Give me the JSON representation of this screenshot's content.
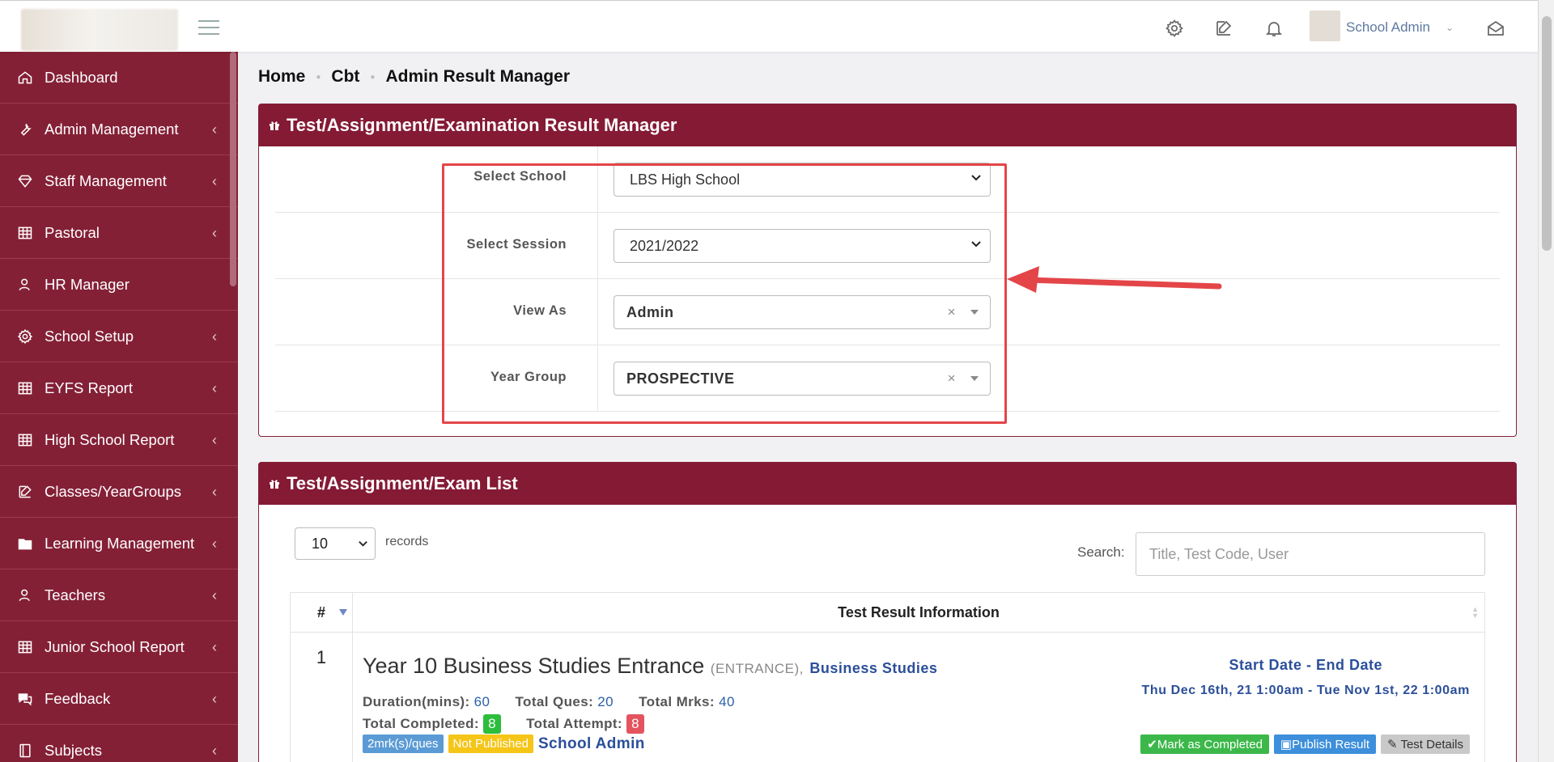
{
  "header": {
    "user_name": "School Admin",
    "icons": [
      "gear-icon",
      "edit-icon",
      "bell-icon",
      "mail-open-icon"
    ]
  },
  "sidebar": {
    "items": [
      {
        "label": "Dashboard",
        "icon": "home-icon",
        "has_chevron": false
      },
      {
        "label": "Admin Management",
        "icon": "wrench-icon",
        "has_chevron": true
      },
      {
        "label": "Staff Management",
        "icon": "diamond-icon",
        "has_chevron": true
      },
      {
        "label": "Pastoral",
        "icon": "grid-icon",
        "has_chevron": true
      },
      {
        "label": "HR Manager",
        "icon": "user-icon",
        "has_chevron": false
      },
      {
        "label": "School Setup",
        "icon": "gear-icon",
        "has_chevron": true
      },
      {
        "label": "EYFS Report",
        "icon": "grid-icon",
        "has_chevron": true
      },
      {
        "label": "High School Report",
        "icon": "grid-icon",
        "has_chevron": true
      },
      {
        "label": "Classes/YearGroups",
        "icon": "edit-icon",
        "has_chevron": true
      },
      {
        "label": "Learning Management",
        "icon": "folder-icon",
        "has_chevron": true
      },
      {
        "label": "Teachers",
        "icon": "user-icon",
        "has_chevron": true
      },
      {
        "label": "Junior School Report",
        "icon": "grid-icon",
        "has_chevron": true
      },
      {
        "label": "Feedback",
        "icon": "chat-icon",
        "has_chevron": true
      },
      {
        "label": "Subjects",
        "icon": "book-icon",
        "has_chevron": true
      }
    ],
    "chevron": "‹"
  },
  "breadcrumb": [
    "Home",
    "Cbt",
    "Admin Result Manager"
  ],
  "filter_panel": {
    "title": "Test/Assignment/Examination Result Manager",
    "fields": [
      {
        "label": "Select School",
        "value": "LBS High School",
        "kind": "select"
      },
      {
        "label": "Select Session",
        "value": "2021/2022",
        "kind": "select"
      },
      {
        "label": "View As",
        "value": "Admin",
        "kind": "select2"
      },
      {
        "label": "Year Group",
        "value": "PROSPECTIVE",
        "kind": "select2"
      }
    ],
    "clear_glyph": "×"
  },
  "list_panel": {
    "title": "Test/Assignment/Exam List",
    "page_length": "10",
    "records_label": "records",
    "search_label": "Search:",
    "search_placeholder": "Title, Test Code, User",
    "columns": [
      "#",
      "Test Result Information"
    ],
    "rows": [
      {
        "index": "1",
        "title": "Year 10 Business Studies Entrance",
        "code": "(ENTRANCE),",
        "subject": "Business Studies",
        "duration_label": "Duration(mins):",
        "duration": "60",
        "ques_label": "Total Ques:",
        "ques": "20",
        "marks_label": "Total Mrks:",
        "marks": "40",
        "completed_label": "Total Completed:",
        "completed": "8",
        "attempt_label": "Total Attempt:",
        "attempt": "8",
        "tag_marks": "2mrk(s)/ques",
        "tag_status": "Not Published",
        "author": "School Admin",
        "dates_heading": "Start Date - End Date",
        "dates_value": "Thu Dec 16th, 21 1:00am - Tue Nov 1st, 22 1:00am",
        "actions": [
          "✔Mark as Completed",
          "Publish Result",
          "Test Details"
        ]
      }
    ]
  },
  "colors": {
    "sidebar_bg": "#842036",
    "panel_header": "#851a35",
    "highlight_box": "#e44548",
    "link_blue": "#2b4f9a",
    "badge_green": "#2cbd3c",
    "badge_red": "#e4545e",
    "tag_blue": "#5b9bd5",
    "tag_yellow": "#f5c518",
    "btn_green": "#3cb84a",
    "btn_blue": "#3d8fdb",
    "btn_grey": "#c9c9c9"
  }
}
